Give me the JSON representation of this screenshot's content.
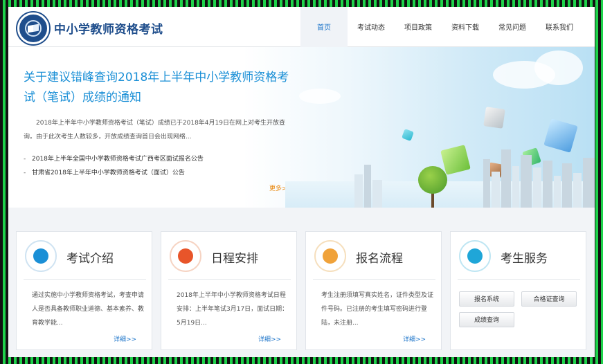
{
  "header": {
    "site_title": "中小学教师资格考试",
    "logo_icon": "seal-logo-icon",
    "nav": [
      {
        "label": "首页",
        "active": true
      },
      {
        "label": "考试动态",
        "active": false
      },
      {
        "label": "项目政策",
        "active": false
      },
      {
        "label": "资料下载",
        "active": false
      },
      {
        "label": "常见问题",
        "active": false
      },
      {
        "label": "联系我们",
        "active": false
      }
    ]
  },
  "banner": {
    "title": "关于建议错峰查询2018年上半年中小学教师资格考试（笔试）成绩的通知",
    "body": "2018年上半年中小学教师资格考试（笔试）成绩已于2018年4月19日在网上对考生开放查询。由于此次考生人数较多，开放成绩查询首日会出现网络...",
    "news": [
      "2018年上半年全国中小学教师资格考试广西考区面试报名公告",
      "甘肃省2018年上半年中小学教师资格考试（面试）公告"
    ],
    "more": "更多>>"
  },
  "cards": [
    {
      "title": "考试介绍",
      "icon": "edit-document-icon",
      "text": "通过实施中小学教师资格考试，考查申请人是否具备教师职业道德、基本素养、教育教学能...",
      "more": "详细>>"
    },
    {
      "title": "日程安排",
      "icon": "checkmark-icon",
      "text": "2018年上半年中小学教师资格考试日程安排：上半年笔试3月17日，面试日期：5月19日...",
      "more": "详细>>"
    },
    {
      "title": "报名流程",
      "icon": "id-card-icon",
      "text": "考生注册须填写真实姓名，证件类型及证件号码。已注册的考生填写密码进行登陆，未注册...",
      "more": "详细>>"
    },
    {
      "title": "考生服务",
      "icon": "contacts-book-icon",
      "buttons": [
        "报名系统",
        "合格证查询",
        "成绩查询"
      ]
    }
  ],
  "colors": {
    "brand": "#1f4e8c",
    "link": "#1a73c9",
    "title_blue": "#1a8fd6",
    "more_orange": "#e8860c",
    "frame_border": "#1ed24a"
  }
}
